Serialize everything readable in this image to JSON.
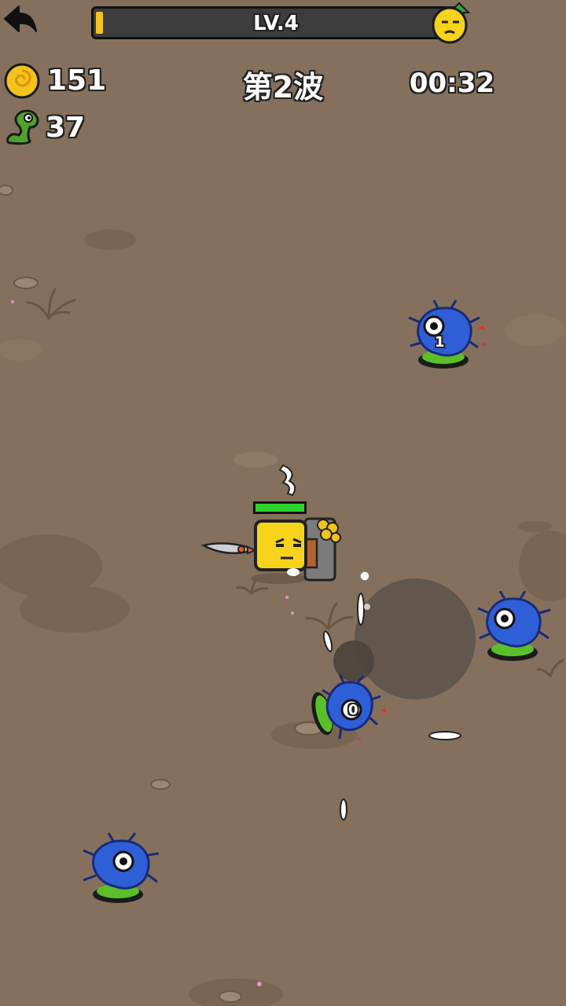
{
  "hud": {
    "level_label": "LV.4",
    "xp_progress": 0.02,
    "wave_label": "第2波",
    "timer": "00:32",
    "coin_count": "151",
    "kill_count": "37"
  },
  "player": {
    "health_progress": 1.0
  },
  "floating_numbers": [
    "1",
    "0"
  ],
  "icons": {
    "back": "back-arrow-icon",
    "coin": "gold-coin-icon",
    "kills": "green-worm-icon",
    "avatar": "player-face-icon",
    "level_up": "level-up-arrow-icon"
  },
  "colors": {
    "ground": "#84705c",
    "xp_fill": "#f3c21e",
    "health": "#2fd32f",
    "enemy_body": "#2f5fd6",
    "enemy_base": "#5bbf2a",
    "player_body": "#f6d31a"
  }
}
